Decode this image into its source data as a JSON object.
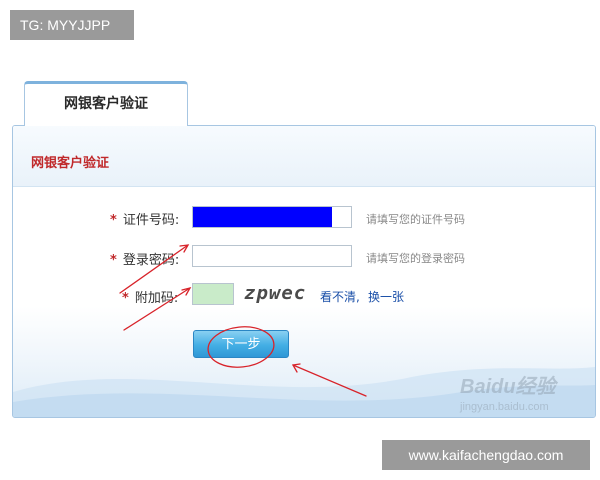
{
  "top_badge": "TG: MYYJJPP",
  "bottom_badge": "www.kaifachengdao.com",
  "tab": {
    "label": "网银客户验证"
  },
  "panel": {
    "title": "网银客户验证"
  },
  "form": {
    "id_number": {
      "star": "*",
      "label": "证件号码:",
      "hint": "请填写您的证件号码",
      "value": ""
    },
    "password": {
      "star": "*",
      "label": "登录密码:",
      "hint": "请填写您的登录密码",
      "value": ""
    },
    "captcha": {
      "star": "*",
      "label": "附加码:",
      "image_text": "zpwec",
      "refresh_text": "看不清,",
      "refresh_link": "换一张"
    }
  },
  "next_button": "下一步",
  "watermark": {
    "logo": "Baidu经验",
    "url": "jingyan.baidu.com"
  },
  "colors": {
    "accent_red": "#c0292b",
    "button_blue": "#43aee4",
    "border_blue": "#a7c6e2",
    "annotation_red": "#d8232a"
  }
}
